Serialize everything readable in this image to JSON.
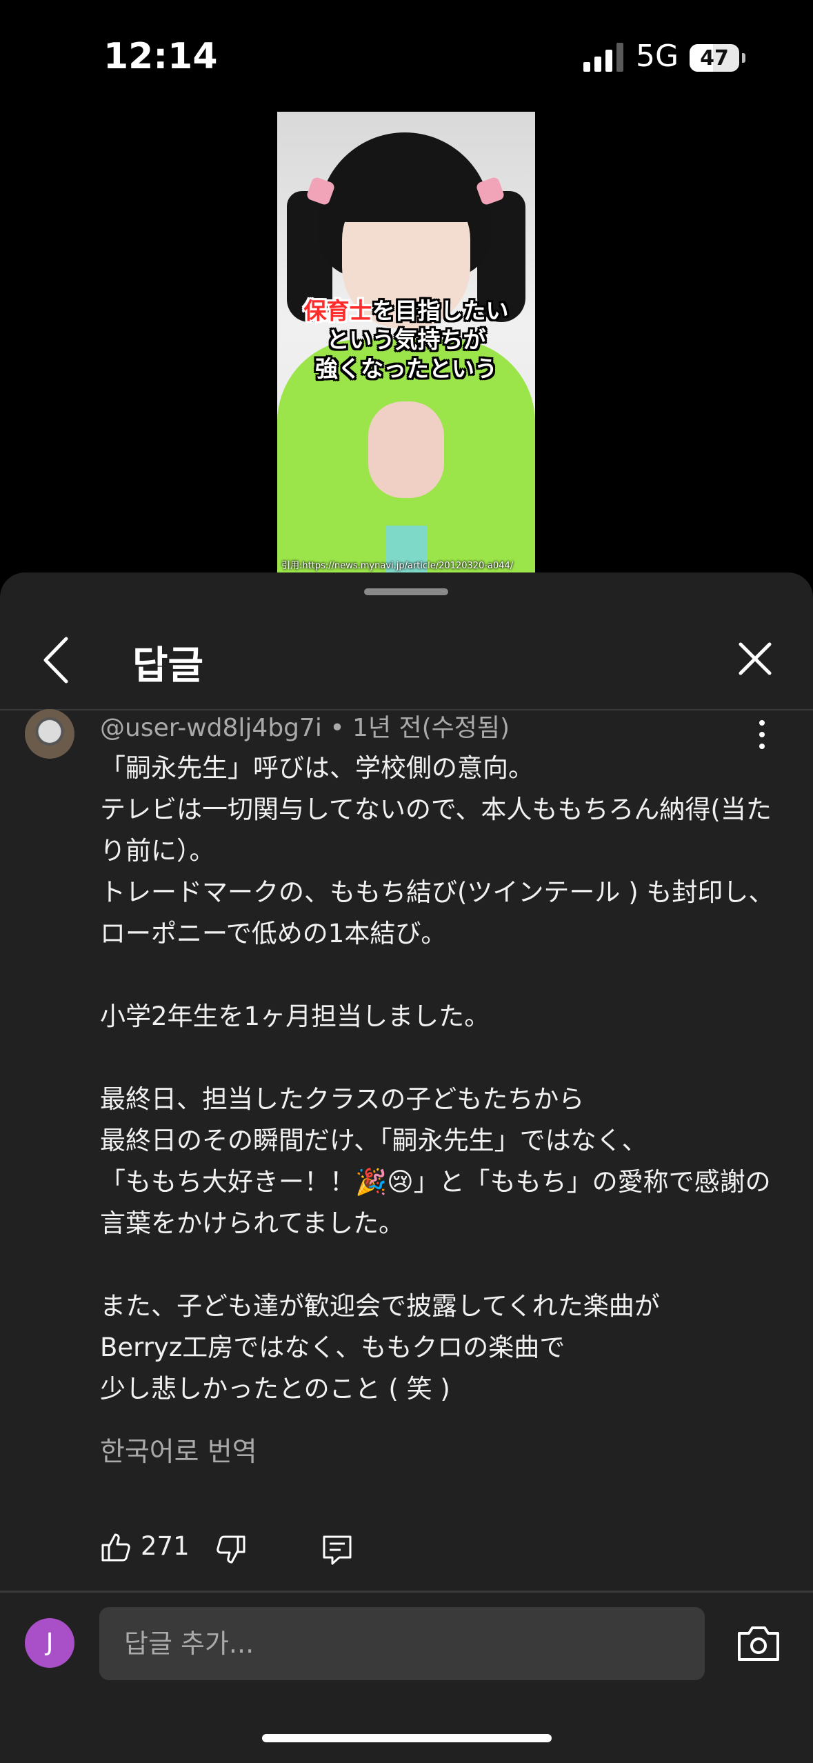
{
  "status_bar": {
    "time": "12:14",
    "network": "5G",
    "battery": "47",
    "battery_level": 0.47
  },
  "video": {
    "caption_highlight": "保育士",
    "caption_line1_rest": "を目指したい",
    "caption_line2": "という気持ちが",
    "caption_line3": "強くなったという",
    "source_credit": "引用:https://news.mynavi.jp/article/20120320-a044/"
  },
  "header": {
    "title": "답글",
    "back_icon": "chevron-left-icon",
    "close_icon": "close-icon"
  },
  "comment": {
    "author_meta": "@user-wd8lj4bg7i • 1년 전(수정됨)",
    "text": "「嗣永先生」呼びは、学校側の意向。\nテレビは一切関与してないので、本人ももちろん納得(当たり前に）。\nトレードマークの、ももち結び(ツインテール ) も封印し、ローポニーで低めの1本結び。\n\n小学2年生を1ヶ月担当しました。\n\n最終日、担当したクラスの子どもたちから\n最終日のその瞬間だけ、「嗣永先生」ではなく、\n「ももち大好きー！！🎉😢」と「ももち」の愛称で感謝の言葉をかけられてました。\n\nまた、子ども達が歓迎会で披露してくれた楽曲が\nBerryz工房ではなく、ももクロの楽曲で\n少し悲しかったとのこと ( 笑 )",
    "translate_label": "한국어로 번역",
    "like_count": "271"
  },
  "composer": {
    "avatar_letter": "J",
    "placeholder": "답글 추가..."
  },
  "colors": {
    "sheet_bg": "#212121",
    "avatar": "#a94fc7",
    "input_bg": "#3a3a3a"
  }
}
